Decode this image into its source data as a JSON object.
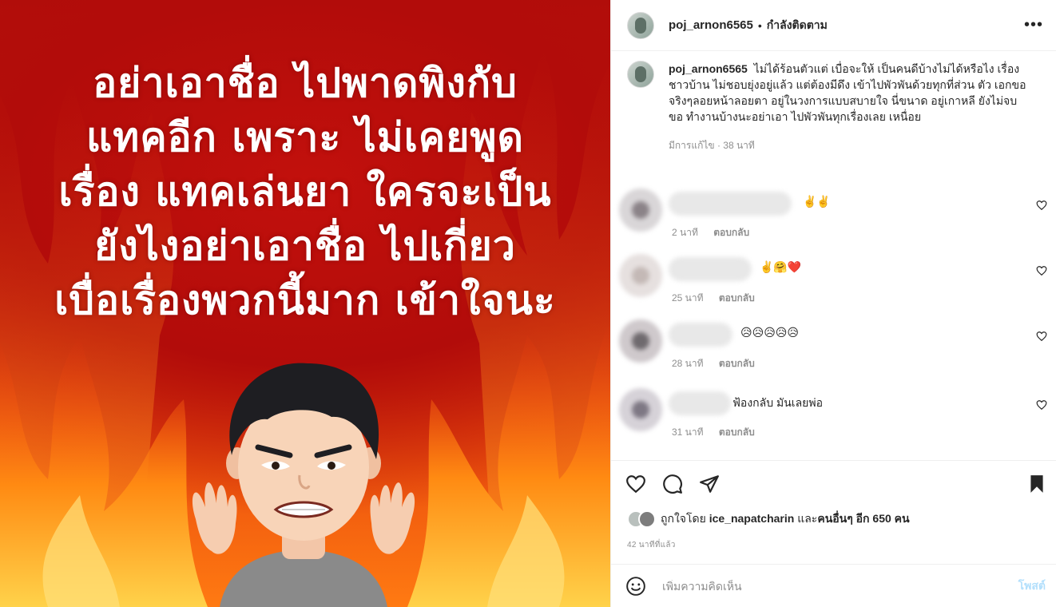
{
  "post_image": {
    "lines": [
      "อย่าเอาชื่อ ไปพาดพิงกับ",
      "แทคอีก เพราะ ไม่เคยพูด",
      "เรื่อง แทคเล่นยา ใครจะเป็น",
      "ยังไงอย่าเอาชื่อ ไปเกี่ยว",
      "เบื่อเรื่องพวกนี้มาก เข้าใจนะ"
    ]
  },
  "header": {
    "username": "poj_arnon6565",
    "separator": "•",
    "follow_label": "กำลังติดตาม",
    "more_label": "•••"
  },
  "caption": {
    "username": "poj_arnon6565",
    "text": "ไม่ได้ร้อนตัวแต่ เบื่อจะให้ เป็นคนดีบ้างไม่ได้หรือไง เรื่องชาวบ้าน ไม่ชอบยุ่งอยู่แล้ว แต่ต้องมีดึง เข้าไปพัวพันด้วยทุกที่ส่วน ตัว เอกขอจริงๆลอยหน้าลอยตา อยู่ในวงการแบบสบายใจ นี่ขนาด อยู่เกาหลี ยังไม่จบ ขอ ทำงานบ้างนะอย่าเอา ไปพัวพันทุกเรื่องเลย เหนื่อย",
    "edited": "มีการแก้ไข",
    "dot": "·",
    "time": "38 นาที"
  },
  "comments": [
    {
      "text": "✌️✌️",
      "time": "2 นาที",
      "reply": "ตอบกลับ"
    },
    {
      "text": "✌️🤗❤️",
      "time": "25 นาที",
      "reply": "ตอบกลับ"
    },
    {
      "text": "😥😥😥😥😥",
      "time": "28 นาที",
      "reply": "ตอบกลับ"
    },
    {
      "text": "ฟ้องกลับ มันเลยพ่อ",
      "time": "31 นาที",
      "reply": "ตอบกลับ"
    }
  ],
  "likes": {
    "prefix": "ถูกใจโดย",
    "user": "ice_napatcharin",
    "and": "และ",
    "others": "คนอื่นๆ อีก 650 คน"
  },
  "time_ago": "42 นาทีที่แล้ว",
  "add_comment": {
    "placeholder": "เพิ่มความคิดเห็น",
    "post_label": "โพสต์"
  },
  "icons": {
    "like": "heart-icon",
    "comment": "comment-icon",
    "share": "share-icon",
    "save": "bookmark-icon",
    "emoji": "emoji-icon"
  },
  "colors": {
    "text": "#262626",
    "muted": "#8e8e8e",
    "post_button_disabled": "#b2dffc",
    "heart_red": "#ed4956"
  }
}
